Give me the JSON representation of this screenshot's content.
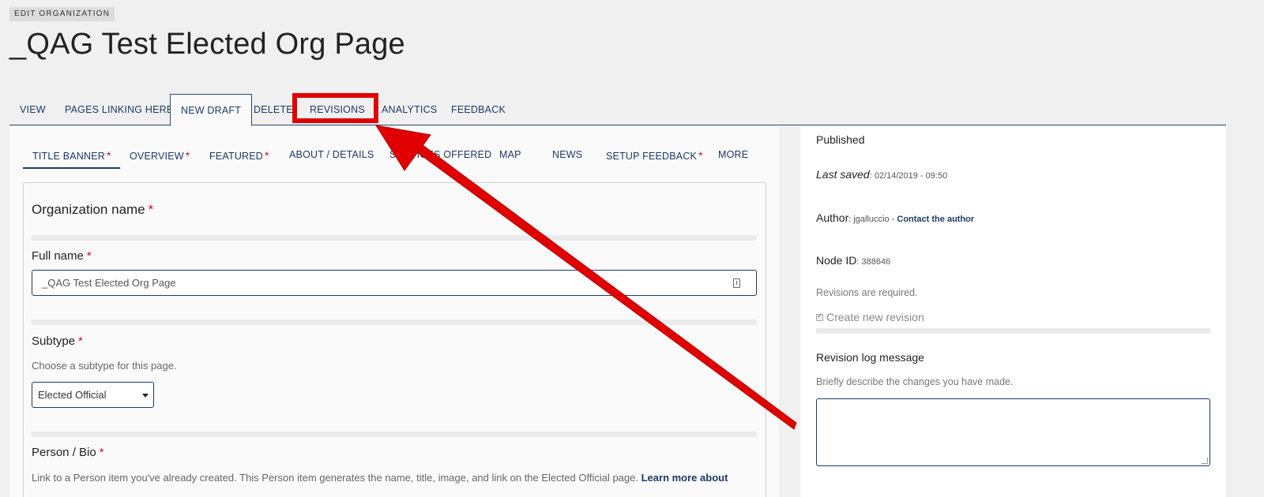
{
  "header": {
    "tag": "EDIT ORGANIZATION",
    "title": "_QAG Test Elected Org Page"
  },
  "primary_tabs": [
    {
      "label": "VIEW"
    },
    {
      "label": "PAGES LINKING HERE"
    },
    {
      "label": "NEW DRAFT"
    },
    {
      "label": "DELETE"
    },
    {
      "label": "REVISIONS"
    },
    {
      "label": "ANALYTICS"
    },
    {
      "label": "FEEDBACK"
    }
  ],
  "secondary_tabs": [
    {
      "label": "TITLE BANNER",
      "required": "*"
    },
    {
      "label": "OVERVIEW",
      "required": "*"
    },
    {
      "label": "FEATURED",
      "required": "*"
    },
    {
      "label": "ABOUT / DETAILS"
    },
    {
      "label": "SERVICES OFFERED"
    },
    {
      "label": "MAP"
    },
    {
      "label": "NEWS"
    },
    {
      "label": "SETUP FEEDBACK",
      "required": "*"
    },
    {
      "label": "MORE"
    }
  ],
  "form": {
    "org_name_heading": "Organization name",
    "full_name_label": "Full name",
    "full_name_value": "_QAG Test Elected Org Page",
    "subtype_label": "Subtype",
    "subtype_help": "Choose a subtype for this page.",
    "subtype_value": "Elected Official",
    "person_bio_label": "Person / Bio",
    "person_bio_help": "Link to a Person item you've already created. This Person item generates the name, title, image, and link on the Elected Official page.",
    "person_bio_link": "Learn more about",
    "required_marker": "*"
  },
  "sidebar": {
    "status": "Published",
    "last_saved_label": "Last saved",
    "last_saved_value": ": 02/14/2019 - 09:50",
    "author_label": "Author",
    "author_value": ": jgalluccio - ",
    "contact_link": "Contact the author",
    "node_id_label": "Node ID",
    "node_id_value": ": 388646",
    "revisions_required": "Revisions are required.",
    "create_revision_label": "Create new revision",
    "revision_log_label": "Revision log message",
    "revision_log_help": "Briefly describe the changes you have made.",
    "revision_log_value": ""
  },
  "colors": {
    "accent": "#1e3a63",
    "required": "#c8102e",
    "highlight": "#e00000"
  }
}
